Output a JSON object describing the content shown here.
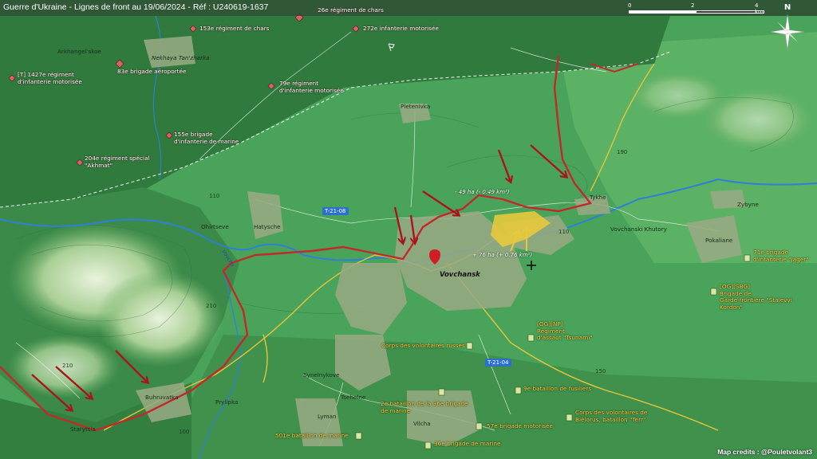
{
  "title": "Guerre d'Ukraine - Lignes de front au 19/06/2024 - Réf : U240619-1637",
  "scale": {
    "labels": [
      "0",
      "2",
      "4 km"
    ]
  },
  "north": "N",
  "russian_units": [
    "26e régiment de chars",
    "153e régiment de chars",
    "272e infanterie motorisée",
    "[T] 1427e régiment\nd'infanterie motorisée",
    "83e brigade aéroportée",
    "79e régiment\nd'infanterie motorisée",
    "155e brigade\nd'infanterie de marine",
    "204e régiment spécial\n\"Akhmat\""
  ],
  "ukrainian_units": [
    "71e brigade\nd'infanterie \"Jager\"",
    "[OG][SBG]\nBrigade de\nGarde-frontière \"Stalevyi\nKordon\"",
    "[OG][NP]\nRégiment\nd'assaut \"Tsunami\"",
    "Corps des volontaires russes",
    "9e bataillon de fusiliers",
    "2e bataillon de la 36e brigade\nde marine",
    "57e brigade motorisée",
    "Corps des volontaires de\nBiélorus, bataillon \"Terr\"",
    "501e bataillon de marine",
    "36e brigade de marine"
  ],
  "places": [
    "Arkhangel'skoe",
    "Nekhaya Tan'zharka",
    "Pletenivka",
    "Tykhe",
    "Zybyne",
    "Ohirtseve",
    "Hatysche",
    "Vovchanski Khutory",
    "Pokaliane",
    "Vovchansk",
    "Synelnykove",
    "Tsehelne",
    "Buhruvatka",
    "Prylipka",
    "Starytsia",
    "Lyman",
    "Vilcha"
  ],
  "contours": [
    "190",
    "110",
    "110",
    "210",
    "210",
    "150",
    "100"
  ],
  "roads": [
    "T-21-08",
    "T-21-04"
  ],
  "areas": [
    "- 49 ha (- 0.49 km²)",
    "+ 76 ha (+ 0.76 km²)"
  ],
  "river": "Vovcha",
  "credit": "Map credits : @Pouletvolant3",
  "colors": {
    "ru_controlled": "#2f7a3c",
    "ua_terrain": "#4aa35a",
    "front_line": "#c2292b",
    "attack_arrow": "#a7161c",
    "river": "#2e7fd6",
    "road": "#e6c43a",
    "gain_area": "#e8c93c",
    "ru_marker": "#d9626a",
    "ua_marker": "#d9e8a6"
  },
  "icons": {
    "ru_unit": "diamond-marker-icon",
    "ua_unit": "square-flag-marker-icon",
    "north": "compass-rose-icon",
    "cross": "cross-marker-icon",
    "pin": "map-pin-icon"
  }
}
